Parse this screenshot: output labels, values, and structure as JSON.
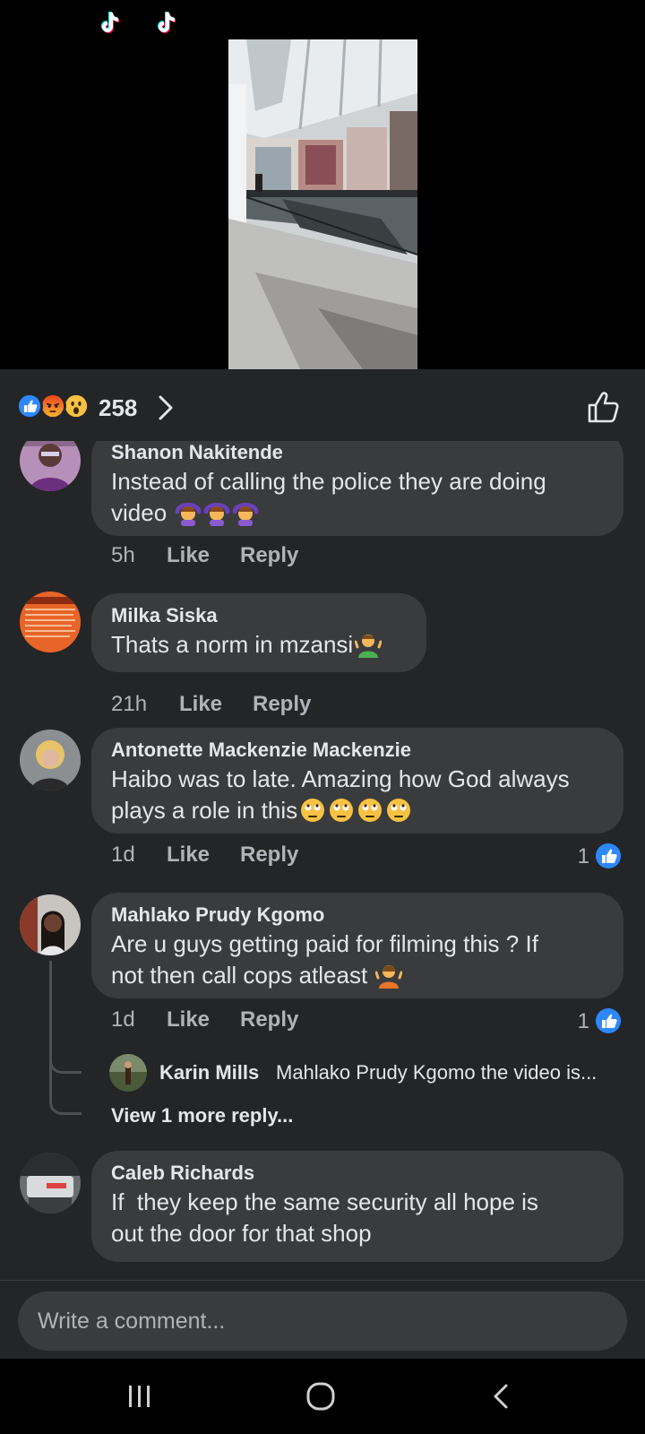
{
  "reactions": {
    "icons": [
      "like-reaction-icon",
      "angry-reaction-icon",
      "wow-reaction-icon"
    ],
    "count": "258"
  },
  "colors": {
    "background": "#242526",
    "bubble": "#3a3b3c",
    "primary_text": "#e4e6eb",
    "secondary_text": "#b0b3b8",
    "like_blue": "#2d88ff"
  },
  "comments": [
    {
      "author": "Shanon Nakitende",
      "text_line1": "Instead of calling the police they are doing",
      "text_line2": "video",
      "emojis": [
        "woman-gesturing-ok-emoji",
        "woman-gesturing-ok-emoji",
        "woman-gesturing-ok-emoji"
      ],
      "time": "5h",
      "like": "Like",
      "reply": "Reply"
    },
    {
      "author": "Milka Siska",
      "text_line1": "Thats a norm in mzansi",
      "emojis": [
        "man-shrugging-emoji"
      ],
      "time": "21h",
      "like": "Like",
      "reply": "Reply"
    },
    {
      "author": "Antonette Mackenzie Mackenzie",
      "text_line1": "Haibo was to late. Amazing how God always",
      "text_line2": "plays a role in this",
      "emojis": [
        "rolling-eyes-emoji",
        "rolling-eyes-emoji",
        "rolling-eyes-emoji",
        "rolling-eyes-emoji"
      ],
      "time": "1d",
      "like": "Like",
      "reply": "Reply",
      "like_count": "1"
    },
    {
      "author": "Mahlako Prudy Kgomo",
      "text_line1": "Are u guys getting paid for filming this ? If",
      "text_line2": "not then call cops atleast",
      "emojis": [
        "person-shrugging-emoji"
      ],
      "time": "1d",
      "like": "Like",
      "reply": "Reply",
      "like_count": "1",
      "reply_preview": {
        "author": "Karin Mills",
        "text": "Mahlako Prudy Kgomo the video is..."
      },
      "view_more": "View 1 more reply..."
    },
    {
      "author": "Caleb Richards",
      "text_line1": "If  they keep the same security all hope is",
      "text_line2": "out the door for that shop"
    }
  ],
  "composer": {
    "placeholder": "Write a comment..."
  },
  "nav": {
    "icons": [
      "recent-apps-icon",
      "home-icon",
      "back-icon"
    ]
  }
}
